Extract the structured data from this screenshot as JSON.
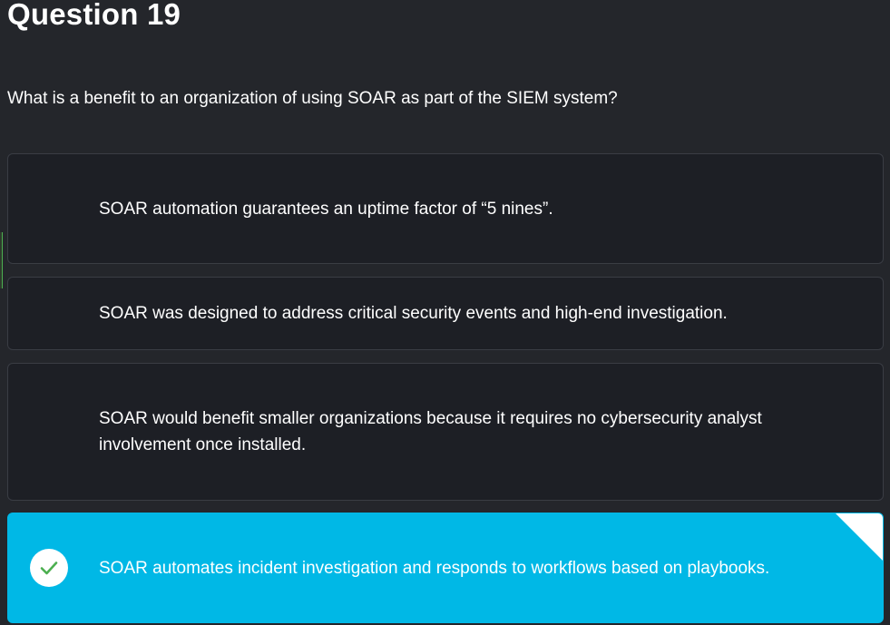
{
  "question": {
    "title": "Question 19",
    "text": "What is a benefit to an organization of using SOAR as part of the SIEM system?"
  },
  "options": [
    {
      "label": "SOAR automation guarantees an uptime factor of “5 nines”.",
      "selected": false
    },
    {
      "label": "SOAR was designed to address critical security events and high-end investigation.",
      "selected": false
    },
    {
      "label": "SOAR would benefit smaller organizations because it requires no cybersecurity analyst involvement once installed.",
      "selected": false
    },
    {
      "label": "SOAR automates incident investigation and responds to workflows based on playbooks.",
      "selected": true
    }
  ],
  "icons": {
    "correct": "check-icon",
    "corner": "corner-fold-icon"
  },
  "colors": {
    "background": "#24262b",
    "option_background": "#1d1f25",
    "correct_accent": "#00b8e6",
    "check_green": "#4caf50"
  }
}
